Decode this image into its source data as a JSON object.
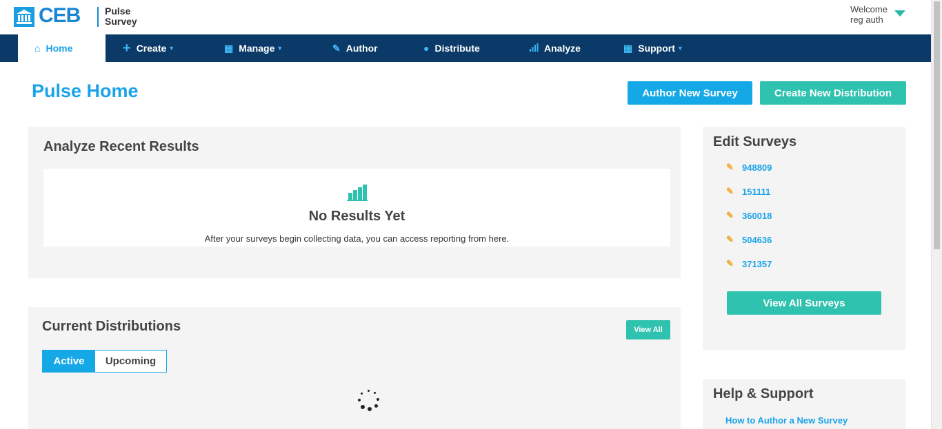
{
  "header": {
    "logo_text": "CEB",
    "product_line1": "Pulse",
    "product_line2": "Survey",
    "welcome_line1": "Welcome",
    "welcome_line2": "reg auth"
  },
  "nav": {
    "items": [
      {
        "label": "Home",
        "icon": "home-icon",
        "active": true
      },
      {
        "label": "Create",
        "icon": "plus-icon",
        "dropdown": true
      },
      {
        "label": "Manage",
        "icon": "grid-icon",
        "dropdown": true
      },
      {
        "label": "Author",
        "icon": "edit-icon"
      },
      {
        "label": "Distribute",
        "icon": "users-icon"
      },
      {
        "label": "Analyze",
        "icon": "bar-chart-icon"
      },
      {
        "label": "Support",
        "icon": "grid-icon",
        "dropdown": true
      }
    ]
  },
  "page": {
    "title": "Pulse Home",
    "author_button": "Author New Survey",
    "distribution_button": "Create New Distribution"
  },
  "analyze": {
    "title": "Analyze Recent Results",
    "empty_title": "No Results Yet",
    "empty_text": "After your surveys begin collecting data, you can access reporting from here."
  },
  "distributions": {
    "title": "Current Distributions",
    "view_all": "View All",
    "tabs": [
      "Active",
      "Upcoming"
    ],
    "active_tab": "Active"
  },
  "edit_surveys": {
    "title": "Edit Surveys",
    "surveys": [
      "948809",
      "151111",
      "360018",
      "504636",
      "371357"
    ],
    "view_all": "View All Surveys"
  },
  "help": {
    "title": "Help & Support",
    "links": [
      "How to Author a New Survey"
    ]
  },
  "colors": {
    "brand_blue": "#1aa3e8",
    "nav_bg": "#0b3a68",
    "teal": "#2fc2ae",
    "edit_icon": "#f0a830"
  }
}
